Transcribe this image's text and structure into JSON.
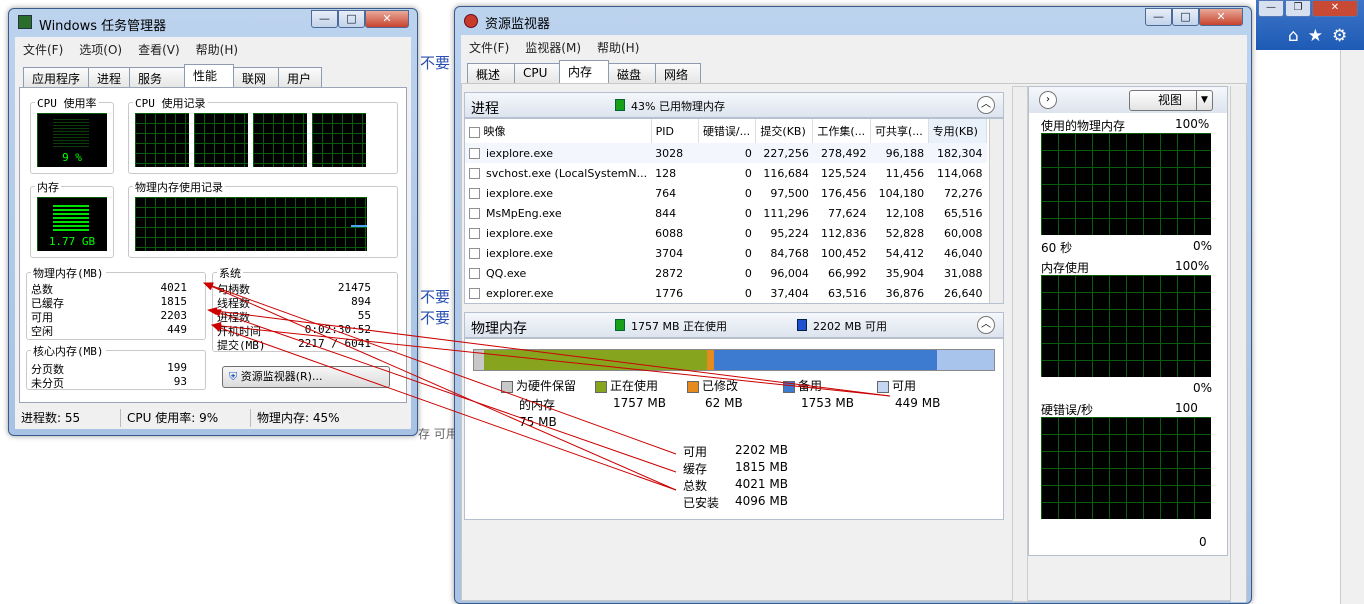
{
  "background": {
    "frag1": "不要",
    "frag2": "不要",
    "frag3": "不要",
    "bottom_frag": "存 可用",
    "btn_min": "—",
    "btn_max": "❐",
    "btn_close": "✕"
  },
  "taskmgr": {
    "title": "Windows 任务管理器",
    "menu": [
      "文件(F)",
      "选项(O)",
      "查看(V)",
      "帮助(H)"
    ],
    "tabs": [
      "应用程序",
      "进程",
      "服务",
      "性能",
      "联网",
      "用户"
    ],
    "active_tab": 3,
    "cpu_usage_label": "CPU 使用率",
    "cpu_history_label": "CPU 使用记录",
    "cpu_value": "9 %",
    "mem_label": "内存",
    "mem_history_label": "物理内存使用记录",
    "mem_value": "1.77 GB",
    "physical": {
      "label": "物理内存(MB)",
      "rows": [
        {
          "k": "总数",
          "v": "4021"
        },
        {
          "k": "已缓存",
          "v": "1815"
        },
        {
          "k": "可用",
          "v": "2203"
        },
        {
          "k": "空闲",
          "v": "449"
        }
      ]
    },
    "kernel": {
      "label": "核心内存(MB)",
      "rows": [
        {
          "k": "分页数",
          "v": "199"
        },
        {
          "k": "未分页",
          "v": "93"
        }
      ]
    },
    "system": {
      "label": "系统",
      "rows": [
        {
          "k": "句柄数",
          "v": "21475"
        },
        {
          "k": "线程数",
          "v": "894"
        },
        {
          "k": "进程数",
          "v": "55"
        },
        {
          "k": "开机时间",
          "v": "0:02:30:52"
        },
        {
          "k": "提交(MB)",
          "v": "2217 / 6041"
        }
      ]
    },
    "resmon_button": "资源监视器(R)...",
    "status": [
      "进程数: 55",
      "CPU 使用率: 9%",
      "物理内存: 45%"
    ]
  },
  "resmon": {
    "title": "资源监视器",
    "menu": [
      "文件(F)",
      "监视器(M)",
      "帮助(H)"
    ],
    "tabs": [
      "概述",
      "CPU",
      "内存",
      "磁盘",
      "网络"
    ],
    "active_tab": 2,
    "process_section": {
      "title": "进程",
      "summary": "43% 已用物理内存",
      "columns": [
        "映像",
        "PID",
        "硬错误/...",
        "提交(KB)",
        "工作集(...",
        "可共享(...",
        "专用(KB)"
      ],
      "rows": [
        [
          "iexplore.exe",
          "3028",
          "0",
          "227,256",
          "278,492",
          "96,188",
          "182,304"
        ],
        [
          "svchost.exe (LocalSystemN...",
          "128",
          "0",
          "116,684",
          "125,524",
          "11,456",
          "114,068"
        ],
        [
          "iexplore.exe",
          "764",
          "0",
          "97,500",
          "176,456",
          "104,180",
          "72,276"
        ],
        [
          "MsMpEng.exe",
          "844",
          "0",
          "111,296",
          "77,624",
          "12,108",
          "65,516"
        ],
        [
          "iexplore.exe",
          "6088",
          "0",
          "95,224",
          "112,836",
          "52,828",
          "60,008"
        ],
        [
          "iexplore.exe",
          "3704",
          "0",
          "84,768",
          "100,452",
          "54,412",
          "46,040"
        ],
        [
          "QQ.exe",
          "2872",
          "0",
          "96,004",
          "66,992",
          "35,904",
          "31,088"
        ],
        [
          "explorer.exe",
          "1776",
          "0",
          "37,404",
          "63,516",
          "36,876",
          "26,640"
        ]
      ]
    },
    "physical_section": {
      "title": "物理内存",
      "in_use": "1757 MB 正在使用",
      "available": "2202 MB 可用",
      "bar_segments_mb": [
        {
          "name": "reserved",
          "mb": 75,
          "color": "#c8c8c8"
        },
        {
          "name": "in_use",
          "mb": 1757,
          "color": "#86a41e"
        },
        {
          "name": "modified",
          "mb": 62,
          "color": "#e68a1e"
        },
        {
          "name": "standby",
          "mb": 1753,
          "color": "#3d7bd0"
        },
        {
          "name": "free",
          "mb": 449,
          "color": "#a9c4ec"
        }
      ],
      "legend": [
        {
          "label": "为硬件保留的内存",
          "value": "75 MB",
          "color": "#c8c8c8"
        },
        {
          "label": "正在使用",
          "value": "1757 MB",
          "color": "#86a41e"
        },
        {
          "label": "已修改",
          "value": "62 MB",
          "color": "#e68a1e"
        },
        {
          "label": "备用",
          "value": "1753 MB",
          "color": "#3d7bd0"
        },
        {
          "label": "可用",
          "value": "449 MB",
          "color": "#c4d6f2"
        }
      ],
      "totals": [
        {
          "k": "可用",
          "v": "2202 MB"
        },
        {
          "k": "缓存",
          "v": "1815 MB"
        },
        {
          "k": "总数",
          "v": "4021 MB"
        },
        {
          "k": "已安装",
          "v": "4096 MB"
        }
      ]
    },
    "side": {
      "view_label": "视图",
      "graphs": [
        {
          "title": "使用的物理内存",
          "top": "100%",
          "bottom_left": "60 秒",
          "bottom_right": "0%"
        },
        {
          "title": "内存使用",
          "top": "100%",
          "bottom_left": "",
          "bottom_right": "0%"
        },
        {
          "title": "硬错误/秒",
          "top": "100",
          "bottom_left": "",
          "bottom_right": "0"
        }
      ]
    }
  },
  "colors": {
    "annotation_arrow": "#cc0000",
    "graph_green": "#00ff00",
    "in_use_icon": "#18a018",
    "avail_icon": "#2050d0"
  }
}
